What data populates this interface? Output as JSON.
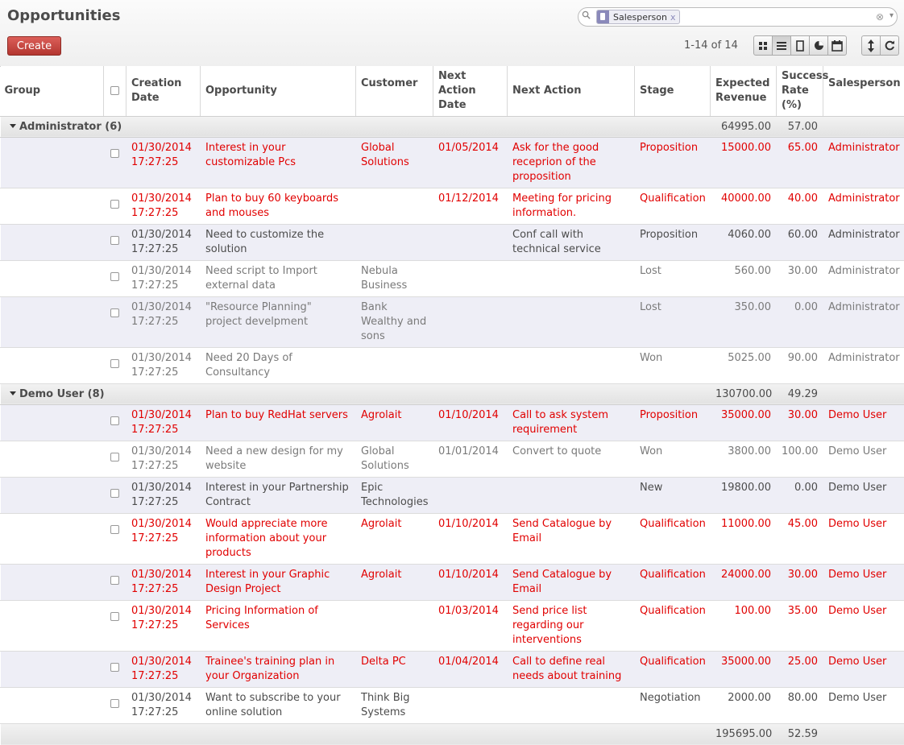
{
  "header": {
    "title": "Opportunities",
    "create_label": "Create"
  },
  "search": {
    "facet_label": "Salesperson",
    "facet_remove": "x",
    "clear": "⊗",
    "dropdown": "▾"
  },
  "pager": {
    "text": "1-14 of 14"
  },
  "view_buttons": [
    "kanban-icon",
    "list-icon",
    "form-icon",
    "graph-icon",
    "calendar-icon"
  ],
  "columns": {
    "group": "Group",
    "creation_date": "Creation Date",
    "opportunity": "Opportunity",
    "customer": "Customer",
    "next_action_date": "Next Action Date",
    "next_action": "Next Action",
    "stage": "Stage",
    "expected_revenue": "Expected Revenue",
    "success_rate": "Success Rate (%)",
    "salesperson": "Salesperson"
  },
  "groups": [
    {
      "label": "Administrator (6)",
      "revenue": "64995.00",
      "rate": "57.00"
    },
    {
      "label": "Demo User (8)",
      "revenue": "130700.00",
      "rate": "49.29"
    }
  ],
  "rows": [
    {
      "date": "01/30/2014 17:27:25",
      "opp": "Interest in your customizable Pcs",
      "cust": "Global Solutions",
      "nad": "01/05/2014",
      "na": "Ask for the good receprion of the proposition",
      "stage": "Proposition",
      "rev": "15000.00",
      "rate": "65.00",
      "sp": "Administrator"
    },
    {
      "date": "01/30/2014 17:27:25",
      "opp": "Plan to buy 60 keyboards and mouses",
      "cust": "",
      "nad": "01/12/2014",
      "na": "Meeting for pricing information.",
      "stage": "Qualification",
      "rev": "40000.00",
      "rate": "40.00",
      "sp": "Administrator"
    },
    {
      "date": "01/30/2014 17:27:25",
      "opp": "Need to customize the solution",
      "cust": "",
      "nad": "",
      "na": "Conf call with technical service",
      "stage": "Proposition",
      "rev": "4060.00",
      "rate": "60.00",
      "sp": "Administrator"
    },
    {
      "date": "01/30/2014 17:27:25",
      "opp": "Need script to Import external data",
      "cust": "Nebula Business",
      "nad": "",
      "na": "",
      "stage": "Lost",
      "rev": "560.00",
      "rate": "30.00",
      "sp": "Administrator"
    },
    {
      "date": "01/30/2014 17:27:25",
      "opp": "\"Resource Planning\" project develpment",
      "cust": "Bank Wealthy and sons",
      "nad": "",
      "na": "",
      "stage": "Lost",
      "rev": "350.00",
      "rate": "0.00",
      "sp": "Administrator"
    },
    {
      "date": "01/30/2014 17:27:25",
      "opp": "Need 20 Days of Consultancy",
      "cust": "",
      "nad": "",
      "na": "",
      "stage": "Won",
      "rev": "5025.00",
      "rate": "90.00",
      "sp": "Administrator"
    },
    {
      "date": "01/30/2014 17:27:25",
      "opp": "Plan to buy RedHat servers",
      "cust": "Agrolait",
      "nad": "01/10/2014",
      "na": "Call to ask system requirement",
      "stage": "Proposition",
      "rev": "35000.00",
      "rate": "30.00",
      "sp": "Demo User"
    },
    {
      "date": "01/30/2014 17:27:25",
      "opp": "Need a new design for my website",
      "cust": "Global Solutions",
      "nad": "01/01/2014",
      "na": "Convert to quote",
      "stage": "Won",
      "rev": "3800.00",
      "rate": "100.00",
      "sp": "Demo User"
    },
    {
      "date": "01/30/2014 17:27:25",
      "opp": "Interest in your Partnership Contract",
      "cust": "Epic Technologies",
      "nad": "",
      "na": "",
      "stage": "New",
      "rev": "19800.00",
      "rate": "0.00",
      "sp": "Demo User"
    },
    {
      "date": "01/30/2014 17:27:25",
      "opp": "Would appreciate more information about your products",
      "cust": "Agrolait",
      "nad": "01/10/2014",
      "na": "Send Catalogue by Email",
      "stage": "Qualification",
      "rev": "11000.00",
      "rate": "45.00",
      "sp": "Demo User"
    },
    {
      "date": "01/30/2014 17:27:25",
      "opp": "Interest in your Graphic Design Project",
      "cust": "Agrolait",
      "nad": "01/10/2014",
      "na": "Send Catalogue by Email",
      "stage": "Qualification",
      "rev": "24000.00",
      "rate": "30.00",
      "sp": "Demo User"
    },
    {
      "date": "01/30/2014 17:27:25",
      "opp": "Pricing Information of Services",
      "cust": "",
      "nad": "01/03/2014",
      "na": "Send price list regarding our interventions",
      "stage": "Qualification",
      "rev": "100.00",
      "rate": "35.00",
      "sp": "Demo User"
    },
    {
      "date": "01/30/2014 17:27:25",
      "opp": "Trainee's training plan in your Organization",
      "cust": "Delta PC",
      "nad": "01/04/2014",
      "na": "Call to define real needs about training",
      "stage": "Qualification",
      "rev": "35000.00",
      "rate": "25.00",
      "sp": "Demo User"
    },
    {
      "date": "01/30/2014 17:27:25",
      "opp": "Want to subscribe to your online solution",
      "cust": "Think Big Systems",
      "nad": "",
      "na": "",
      "stage": "Negotiation",
      "rev": "2000.00",
      "rate": "80.00",
      "sp": "Demo User"
    }
  ],
  "totals": {
    "revenue": "195695.00",
    "rate": "52.59"
  }
}
